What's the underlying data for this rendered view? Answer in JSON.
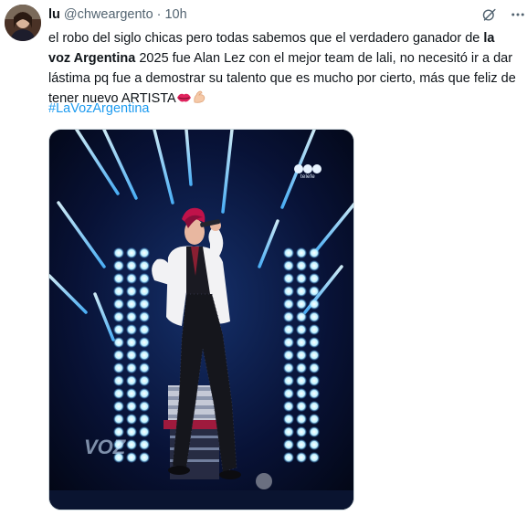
{
  "author": {
    "display_name": "lu",
    "handle": "@chweargento",
    "separator": "·",
    "time": "10h"
  },
  "tweet": {
    "text_part1": "el robo del siglo chicas pero todas sabemos que el verdadero ganador de ",
    "text_bold": "la voz Argentina",
    "text_part2": " 2025 fue Alan Lez con el mejor team de lali, no necesitó ir a dar lástima pq fue a demostrar su talento que es mucho por cierto, más que feliz de tener nuevo ARTISTA",
    "emojis": [
      "kiss-mark-emoji",
      "flexed-biceps-emoji"
    ],
    "hashtag": "#LaVozArgentina"
  },
  "media": {
    "watermark_text": "telefe",
    "stage_logo_text": "VOZ",
    "description_colors": {
      "stage": "#050a1c",
      "light": "#9fe8ff",
      "accent": "#c0124a"
    }
  },
  "icons": [
    "grok-icon",
    "more-icon"
  ]
}
